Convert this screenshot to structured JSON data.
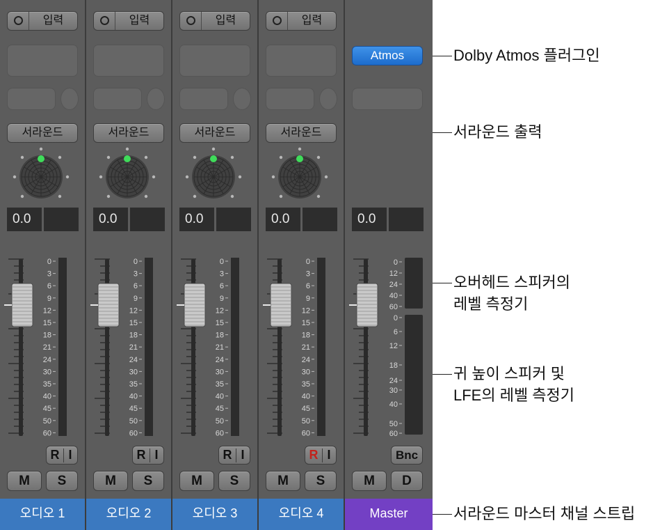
{
  "strips": [
    {
      "name": "오디오 1",
      "input_label": "입력",
      "output_label": "서라운드",
      "volume": "0.0",
      "ri_r": "R",
      "ri_i": "I",
      "mute": "M",
      "solo": "S",
      "record_armed": false
    },
    {
      "name": "오디오 2",
      "input_label": "입력",
      "output_label": "서라운드",
      "volume": "0.0",
      "ri_r": "R",
      "ri_i": "I",
      "mute": "M",
      "solo": "S",
      "record_armed": false
    },
    {
      "name": "오디오 3",
      "input_label": "입력",
      "output_label": "서라운드",
      "volume": "0.0",
      "ri_r": "R",
      "ri_i": "I",
      "mute": "M",
      "solo": "S",
      "record_armed": false
    },
    {
      "name": "오디오 4",
      "input_label": "입력",
      "output_label": "서라운드",
      "volume": "0.0",
      "ri_r": "R",
      "ri_i": "I",
      "mute": "M",
      "solo": "S",
      "record_armed": true
    }
  ],
  "master": {
    "name": "Master",
    "plugin_label": "Atmos",
    "volume": "0.0",
    "bounce_label": "Bnc",
    "mute": "M",
    "dim": "D",
    "meter_top_scale": [
      "0",
      "12",
      "24",
      "40",
      "60"
    ],
    "meter_bottom_scale": [
      "0",
      "6",
      "12",
      "18",
      "24",
      "30",
      "40",
      "50",
      "60"
    ]
  },
  "meter_scale": [
    "0",
    "3",
    "6",
    "9",
    "12",
    "15",
    "18",
    "21",
    "24",
    "30",
    "35",
    "40",
    "45",
    "50",
    "60"
  ],
  "callouts": {
    "plugin": "Dolby Atmos 플러그인",
    "output": "서라운드 출력",
    "overhead_line1": "오버헤드 스피커의",
    "overhead_line2": "레벨 측정기",
    "ear_line1": "귀 높이 스피커 및",
    "ear_line2": "LFE의 레벨 측정기",
    "master_strip": "서라운드 마스터 채널 스트립"
  },
  "colors": {
    "strip_bg": "#5c5c5c",
    "name_bar": "#3b79c0",
    "master_name_bar": "#7340c4",
    "atmos_button": "#2c7fdc",
    "pan_dot": "#3fdc5a",
    "record_red": "#c2221c"
  },
  "icons": {
    "input_toggle": "circle-icon",
    "pan": "surround-panner-icon"
  }
}
